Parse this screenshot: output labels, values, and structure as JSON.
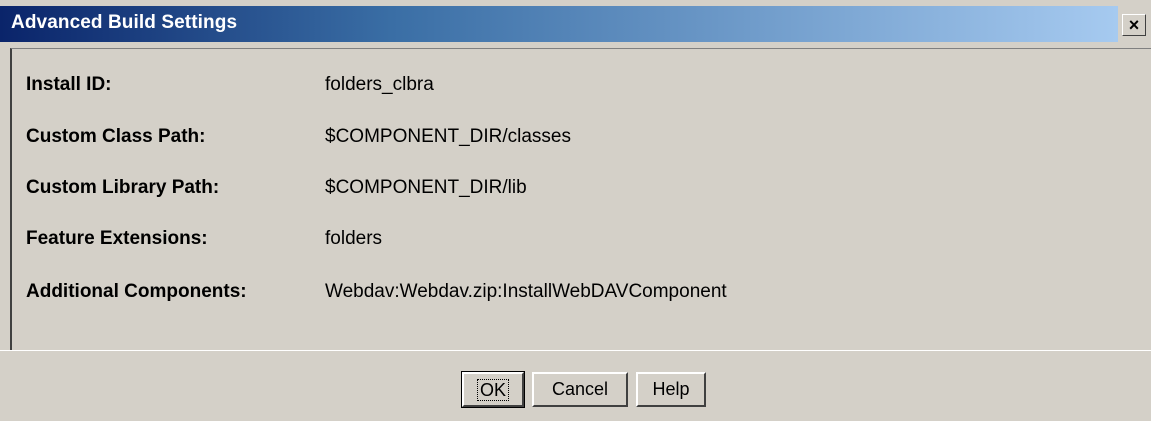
{
  "window": {
    "title": "Advanced Build Settings",
    "close_icon": "×"
  },
  "fields": [
    {
      "label": "Install ID:",
      "value": "folders_clbra"
    },
    {
      "label": "Custom Class Path:",
      "value": "$COMPONENT_DIR/classes"
    },
    {
      "label": "Custom Library Path:",
      "value": "$COMPONENT_DIR/lib"
    },
    {
      "label": "Feature Extensions:",
      "value": "folders"
    },
    {
      "label": "Additional Components:",
      "value": "Webdav:Webdav.zip:InstallWebDAVComponent"
    }
  ],
  "buttons": {
    "ok_label": "OK",
    "cancel_label": "Cancel",
    "help_label": "Help"
  },
  "colors": {
    "title_gradient_start": "#0a246a",
    "title_gradient_end": "#a6caf0",
    "window_face": "#d4d0c8"
  }
}
